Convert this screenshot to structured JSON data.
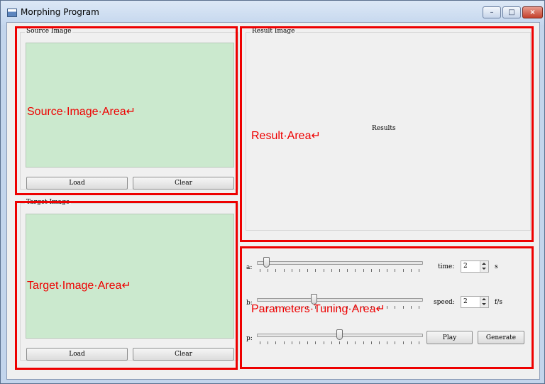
{
  "window": {
    "title": "Morphing Program",
    "controls": {
      "minimize": "–",
      "maximize": "□",
      "close": "×"
    }
  },
  "source": {
    "group_label": "Source Image",
    "load_label": "Load",
    "clear_label": "Clear"
  },
  "target": {
    "group_label": "Target Image",
    "load_label": "Load",
    "clear_label": "Clear"
  },
  "result": {
    "group_label": "Result Image",
    "placeholder": "Results"
  },
  "params": {
    "a_label": "a:",
    "b_label": "b:",
    "p_label": "p:",
    "a_value": 0.04,
    "b_value": 0.34,
    "p_value": 0.5,
    "time_label": "time:",
    "time_value": "2",
    "time_unit": "s",
    "speed_label": "speed:",
    "speed_value": "2",
    "speed_unit": "f/s",
    "play_label": "Play",
    "generate_label": "Generate"
  },
  "annotations": {
    "source": "Source·Image·Area↵",
    "target": "Target·Image·Area↵",
    "result": "Result·Area↵",
    "params": "Parameters·Tuning·Area↵"
  },
  "colors": {
    "annotation": "#ee0000",
    "image_area": "#cbe9ce"
  }
}
